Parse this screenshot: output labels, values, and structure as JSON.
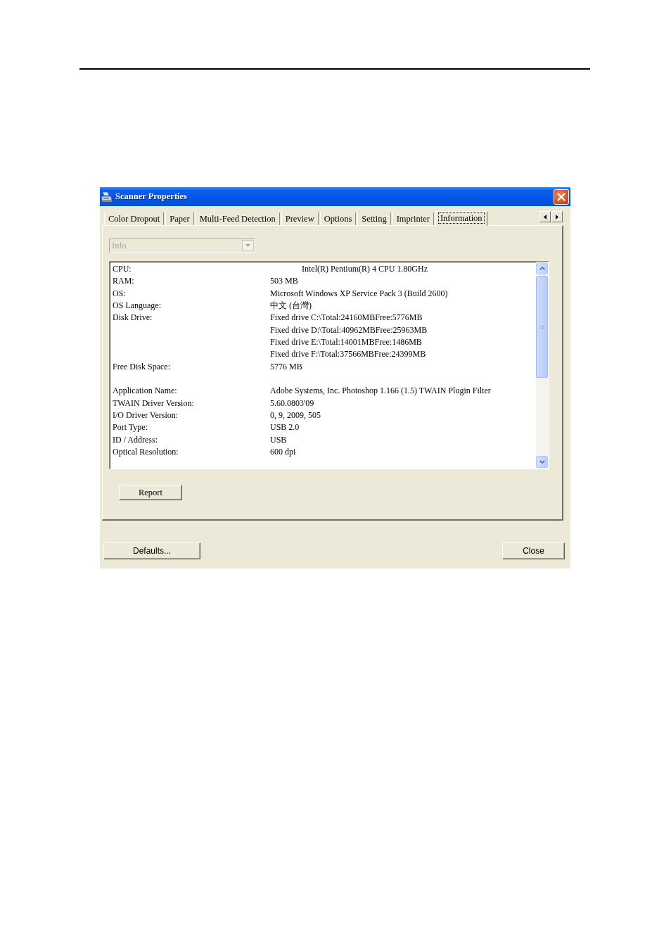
{
  "window": {
    "title": "Scanner Properties"
  },
  "tabs": [
    {
      "label": "Color Dropout",
      "selected": false
    },
    {
      "label": "Paper",
      "selected": false
    },
    {
      "label": "Multi-Feed Detection",
      "selected": false
    },
    {
      "label": "Preview",
      "selected": false
    },
    {
      "label": "Options",
      "selected": false
    },
    {
      "label": "Setting",
      "selected": false
    },
    {
      "label": "Imprinter",
      "selected": false
    },
    {
      "label": "Information",
      "selected": true
    }
  ],
  "dropdown": {
    "value": "Info",
    "disabled": true
  },
  "info_list": {
    "sections": [
      {
        "rows": [
          {
            "label": "CPU:",
            "values": [
              "Intel(R) Pentium(R) 4 CPU 1.80GHz"
            ],
            "indented": true
          },
          {
            "label": "RAM:",
            "values": [
              "503 MB"
            ],
            "indented": false
          },
          {
            "label": "OS:",
            "values": [
              "Microsoft Windows XP Service Pack 3 (Build 2600)"
            ],
            "indented": false
          },
          {
            "label": "OS Language:",
            "values": [
              "中文 (台灣)"
            ],
            "indented": false
          },
          {
            "label": "Disk Drive:",
            "values": [
              "Fixed drive C:\\Total:24160MBFree:5776MB",
              "Fixed drive D:\\Total:40962MBFree:25963MB",
              "Fixed drive E:\\Total:14001MBFree:1486MB",
              "Fixed drive F:\\Total:37566MBFree:24399MB"
            ],
            "indented": false
          },
          {
            "label": "Free Disk Space:",
            "values": [
              "5776 MB"
            ],
            "indented": false
          }
        ]
      },
      {
        "rows": [
          {
            "label": "Application Name:",
            "values": [
              "Adobe Systems, Inc. Photoshop 1.166 (1.5) TWAIN Plugin Filter"
            ],
            "indented": false
          },
          {
            "label": "TWAIN Driver Version:",
            "values": [
              "5.60.0803'09"
            ],
            "indented": false
          },
          {
            "label": "I/O Driver Version:",
            "values": [
              "0, 9, 2009, 505"
            ],
            "indented": false
          },
          {
            "label": "Port Type:",
            "values": [
              "USB 2.0"
            ],
            "indented": false
          },
          {
            "label": "ID / Address:",
            "values": [
              "USB"
            ],
            "indented": false
          },
          {
            "label": "Optical Resolution:",
            "values": [
              "600 dpi"
            ],
            "indented": false
          }
        ]
      }
    ]
  },
  "panel_buttons": [
    "Report"
  ],
  "buttons": [
    "Defaults...",
    "Close"
  ]
}
